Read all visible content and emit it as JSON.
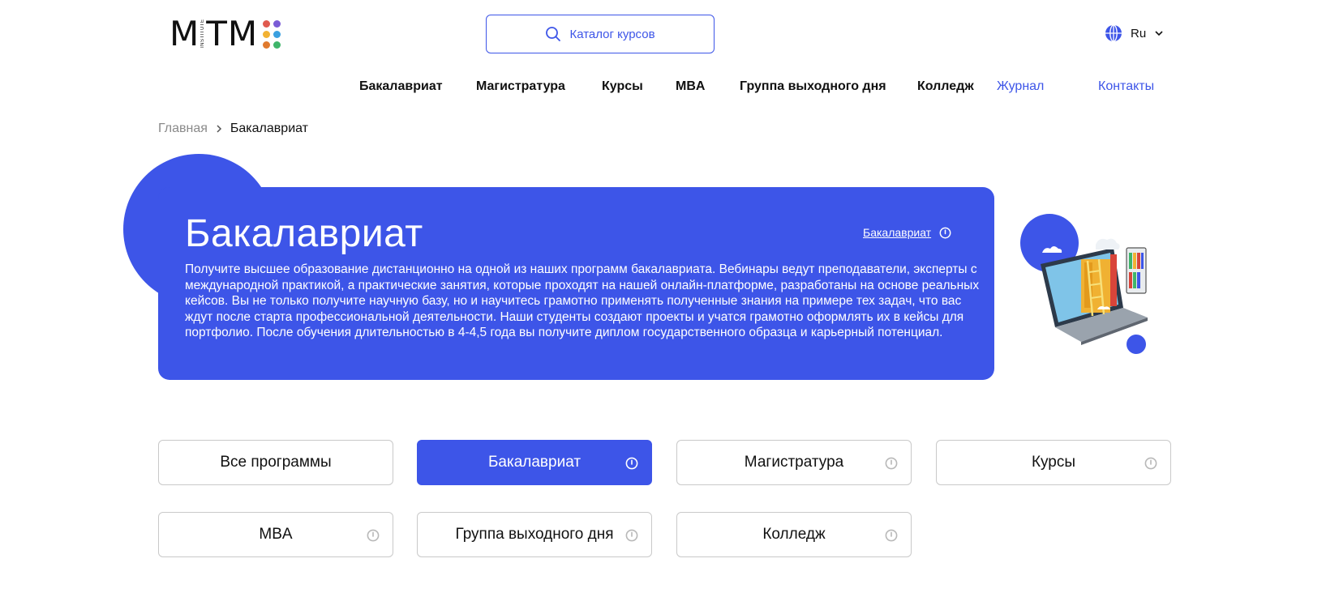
{
  "header": {
    "logo": {
      "text": "MTM",
      "sub": "INSTITUTE",
      "dot_colors": [
        "#e05a4f",
        "#7a5cd6",
        "#f2b233",
        "#3aa0e0",
        "#e07a2e",
        "#3fb56a"
      ]
    },
    "search_label": "Каталог курсов",
    "lang_label": "Ru"
  },
  "nav": {
    "items": [
      "Бакалавриат",
      "Магистратура",
      "Курсы",
      "MBA",
      "Группа выходного дня",
      "Колледж"
    ],
    "journal": "Журнал",
    "contacts": "Контакты"
  },
  "breadcrumb": {
    "home": "Главная",
    "current": "Бакалавриат"
  },
  "hero": {
    "title": "Бакалавриат",
    "link_label": "Бакалавриат",
    "text": "Получите высшее образование дистанционно на одной из наших программ бакалавриата. Вебинары ведут преподаватели, эксперты с международной практикой, а практические занятия, которые проходят на нашей онлайн-платформе, разработаны на основе реальных кейсов. Вы не только получите научную базу, но и научитесь грамотно применять полученные знания на примере тех задач, что вас ждут после старта профессиональной деятельности. Наши студенты создают проекты и учатся грамотно оформлять их в кейсы для портфолио. После обучения длительностью в 4-4,5 года вы получите диплом государственного образца и карьерный потенциал."
  },
  "filters": {
    "items": [
      "Все программы",
      "Бакалавриат",
      "Магистратура",
      "Курсы",
      "MBA",
      "Группа выходного дня",
      "Колледж"
    ],
    "active": "Бакалавриат"
  },
  "colors": {
    "accent": "#3d55e8",
    "border": "#c9c9c9",
    "muted": "#8a8a8a"
  },
  "icons": [
    "search-icon",
    "globe-icon",
    "chevron-down-icon",
    "chevron-right-icon",
    "info-icon"
  ]
}
